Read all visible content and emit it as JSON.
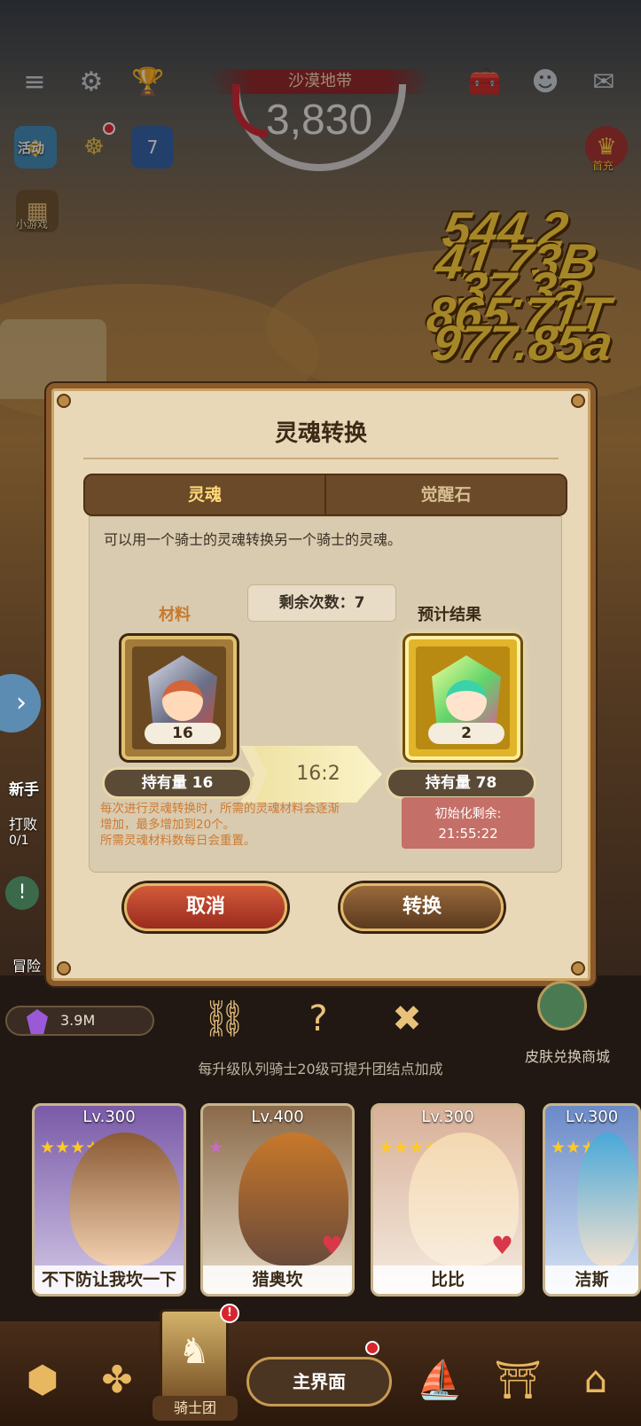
{
  "top_bar": {
    "zone_name": "沙漠地带",
    "score": "3,830"
  },
  "side": {
    "activity_label": "活动",
    "calendar_day": "7",
    "minigame_label": "小游戏",
    "first_purchase_label": "首充",
    "new_hand_label": "新手",
    "defeat_label": "打败",
    "defeat_progress": "0/1",
    "adventure_label": "冒险"
  },
  "damage_numbers": [
    "544.2",
    "41.73B",
    "37.3a",
    "865.71T",
    "977.85a"
  ],
  "dialog": {
    "title": "灵魂转换",
    "tabs": [
      {
        "label": "灵魂",
        "active": true
      },
      {
        "label": "觉醒石",
        "active": false
      }
    ],
    "description": "可以用一个骑士的灵魂转换另一个骑士的灵魂。",
    "remaining": "剩余次数：7",
    "material": {
      "label": "材料",
      "count": "16",
      "owned": "持有量 16"
    },
    "result": {
      "label": "预计结果",
      "count": "2",
      "owned": "持有量 78"
    },
    "ratio": "16:2",
    "note_lines": [
      "每次进行灵魂转换时，所需的灵魂材料会逐渐",
      "增加，最多增加到20个。",
      "所需灵魂材料数每日会重置。"
    ],
    "reset_label": "初始化剩余:",
    "reset_time": "21:55:22",
    "cancel_button": "取消",
    "convert_button": "转换"
  },
  "resource": {
    "value": "3.9M"
  },
  "skin_shop_label": "皮肤兑换商城",
  "hint": "每升级队列骑士20级可提升团结点加成",
  "knights": [
    {
      "level": "Lv.300",
      "name": "不下防让我坎一下",
      "stars": 5
    },
    {
      "level": "Lv.400",
      "name": "猎奥坎",
      "stars": 1
    },
    {
      "level": "Lv.300",
      "name": "比比",
      "stars": 4
    },
    {
      "level": "Lv.300",
      "name": "洁斯",
      "stars": 4
    }
  ],
  "nav": {
    "knight_label": "骑士团",
    "main_label": "主界面"
  },
  "colors": {
    "dialog_bg": "#e8d8b8",
    "tab_active": "#ffd976",
    "cancel": "#c0432c",
    "note": "#cf7a30",
    "reset_box": "#c47068"
  }
}
